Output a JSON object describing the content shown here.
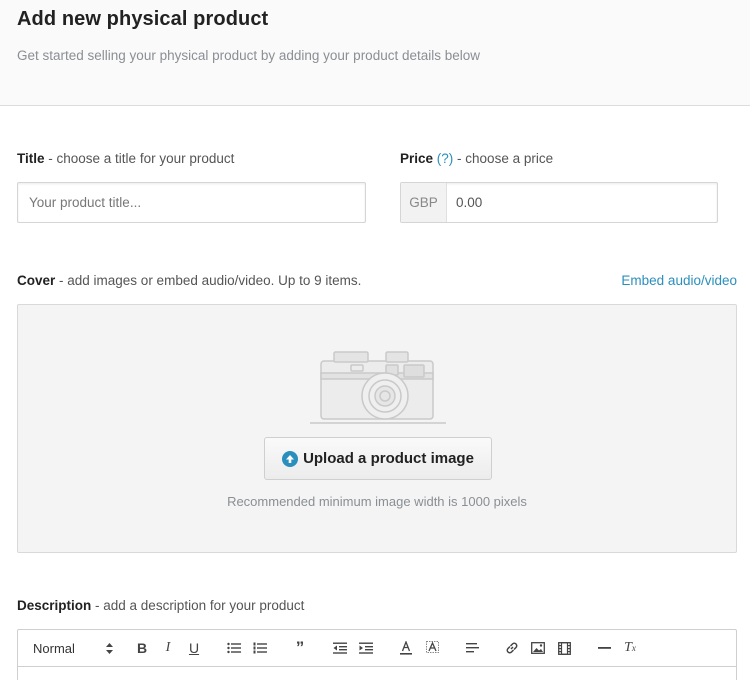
{
  "header": {
    "title": "Add new physical product",
    "subtitle": "Get started selling your physical product by adding your product details below"
  },
  "title_field": {
    "label": "Title",
    "hint": " - choose a title for your product",
    "placeholder": "Your product title..."
  },
  "price_field": {
    "label": "Price",
    "help": "(?)",
    "hint": " - choose a price",
    "currency": "GBP",
    "placeholder": "0.00"
  },
  "cover": {
    "label": "Cover",
    "hint": " - add images or embed audio/video. Up to 9 items.",
    "embed_link": "Embed audio/video",
    "upload_label": "Upload a product image",
    "recommendation": "Recommended minimum image width is 1000 pixels"
  },
  "description": {
    "label": "Description",
    "hint": " - add a description for your product",
    "toolbar": {
      "format_select": "Normal",
      "buttons": [
        "bold",
        "italic",
        "underline",
        "bullet-list",
        "ordered-list",
        "blockquote",
        "outdent",
        "indent",
        "text-color",
        "background-color",
        "align",
        "link",
        "image",
        "video",
        "horizontal-rule",
        "clear-format"
      ]
    }
  },
  "colors": {
    "accent": "#2a8fbd",
    "muted_text": "#8a8f94"
  }
}
